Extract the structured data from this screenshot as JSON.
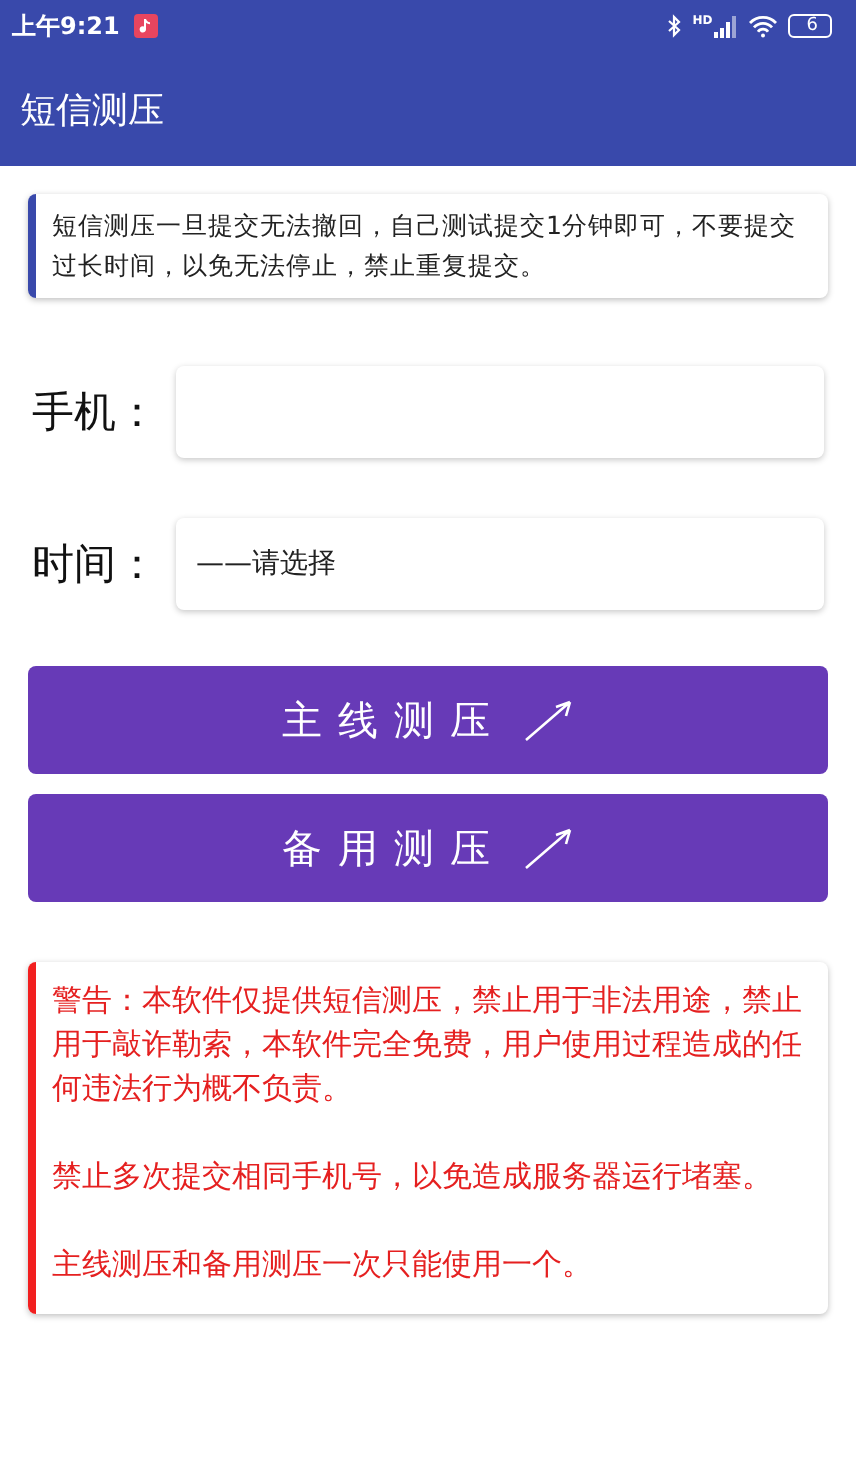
{
  "status_bar": {
    "time": "上午9:21",
    "network": "HD",
    "battery": "6"
  },
  "app_bar": {
    "title": "短信测压"
  },
  "notice": "短信测压一旦提交无法撤回，自己测试提交1分钟即可，不要提交过长时间，以免无法停止，禁止重复提交。",
  "fields": [
    {
      "label": "手机：",
      "kind": "input"
    },
    {
      "label": "时间：",
      "kind": "select",
      "value": "——请选择"
    }
  ],
  "buttons": [
    "主线测压",
    "备用测压"
  ],
  "warning": [
    "警告：本软件仅提供短信测压，禁止用于非法用途，禁止用于敲诈勒索，本软件完全免费，用户使用过程造成的任何违法行为概不负责。",
    "禁止多次提交相同手机号，以免造成服务器运行堵塞。",
    "主线测压和备用测压一次只能使用一个。"
  ]
}
